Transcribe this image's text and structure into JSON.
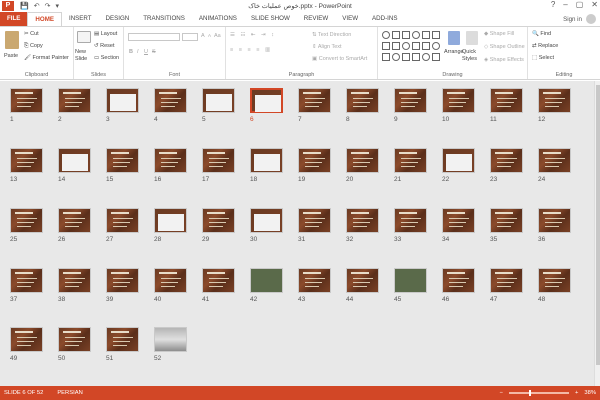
{
  "window": {
    "title": "خوص عملیات خاک.pptx - PowerPoint",
    "min": "–",
    "max": "▢",
    "close": "✕",
    "help": "?"
  },
  "qat": {
    "save": "💾",
    "undo": "↶",
    "redo": "↷",
    "more": "▾"
  },
  "tabs": [
    "FILE",
    "HOME",
    "INSERT",
    "DESIGN",
    "TRANSITIONS",
    "ANIMATIONS",
    "SLIDE SHOW",
    "REVIEW",
    "VIEW",
    "ADD-INS"
  ],
  "active_tab": "HOME",
  "account": {
    "signin": "Sign in"
  },
  "ribbon": {
    "clipboard": {
      "label": "Clipboard",
      "paste": "Paste",
      "cut": "Cut",
      "copy": "Copy",
      "format_painter": "Format Painter"
    },
    "slides": {
      "label": "Slides",
      "new_slide": "New Slide",
      "layout": "Layout",
      "reset": "Reset",
      "section": "Section"
    },
    "font": {
      "label": "Font",
      "bold": "B",
      "italic": "I",
      "underline": "U",
      "strike": "S",
      "grow": "A",
      "shrink": "A",
      "clear": "Aa"
    },
    "paragraph": {
      "label": "Paragraph",
      "text_direction": "Text Direction",
      "align_text": "Align Text",
      "convert": "Convert to SmartArt"
    },
    "drawing": {
      "label": "Drawing",
      "arrange": "Arrange",
      "quick_styles": "Quick Styles",
      "shape_fill": "Shape Fill",
      "shape_outline": "Shape Outline",
      "shape_effects": "Shape Effects"
    },
    "editing": {
      "label": "Editing",
      "find": "Find",
      "replace": "Replace",
      "select": "Select"
    }
  },
  "slides": [
    "1",
    "2",
    "3",
    "4",
    "5",
    "6",
    "7",
    "8",
    "9",
    "10",
    "11",
    "12",
    "13",
    "14",
    "15",
    "16",
    "17",
    "18",
    "19",
    "20",
    "21",
    "22",
    "23",
    "24",
    "25",
    "26",
    "27",
    "28",
    "29",
    "30",
    "31",
    "32",
    "33",
    "34",
    "35",
    "36",
    "37",
    "38",
    "39",
    "40",
    "41",
    "42",
    "43",
    "44",
    "45",
    "46",
    "47",
    "48",
    "49",
    "50",
    "51",
    "52"
  ],
  "selected_slide": "6",
  "status": {
    "slide": "SLIDE 6 OF 52",
    "lang": "PERSIAN",
    "zoom": "38%",
    "minus": "−",
    "plus": "+"
  }
}
